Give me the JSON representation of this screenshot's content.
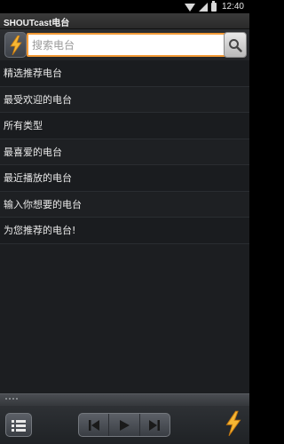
{
  "status_bar": {
    "time": "12:40",
    "icons": [
      "wifi-icon",
      "signal-icon",
      "battery-icon"
    ]
  },
  "app": {
    "title": "SHOUTcast电台"
  },
  "search": {
    "placeholder": "搜索电台",
    "value": ""
  },
  "menu": {
    "items": [
      {
        "label": "精选推荐电台"
      },
      {
        "label": "最受欢迎的电台"
      },
      {
        "label": "所有类型"
      },
      {
        "label": "最喜爱的电台"
      },
      {
        "label": "最近播放的电台"
      },
      {
        "label": "输入你想要的电台"
      },
      {
        "label": "为您推荐的电台!"
      }
    ]
  },
  "toolbar": {
    "menu_icon": "list-icon",
    "prev_icon": "skip-previous-icon",
    "play_icon": "play-icon",
    "next_icon": "skip-next-icon",
    "logo_icon": "shoutcast-logo-icon"
  },
  "colors": {
    "accent": "#f29a36",
    "background": "#1c1e21",
    "text": "#e9e9e9"
  }
}
